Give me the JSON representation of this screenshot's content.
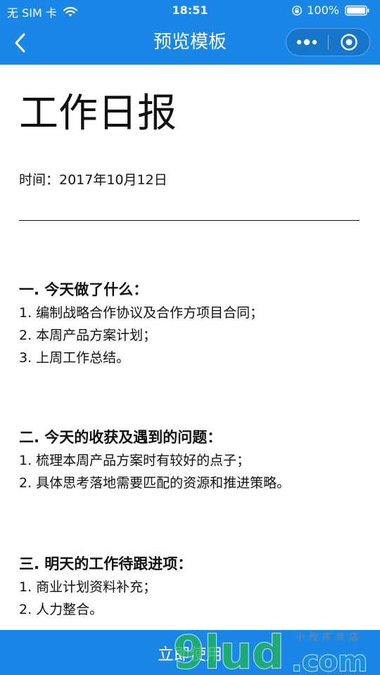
{
  "status_bar": {
    "carrier": "无 SIM 卡",
    "time": "18:51",
    "battery": "100%"
  },
  "nav": {
    "title": "预览模板"
  },
  "document": {
    "title": "工作日报",
    "date": "时间：2017年10月12日",
    "sections": [
      {
        "heading": "一. 今天做了什么：",
        "items": [
          "1. 编制战略合作协议及合作方项目合同；",
          "2. 本周产品方案计划；",
          "3. 上周工作总结。"
        ]
      },
      {
        "heading": "二. 今天的收获及遇到的问题：",
        "items": [
          "1. 梳理本周产品方案时有较好的点子；",
          "2. 具体思考落地需要匹配的资源和推进策略。"
        ]
      },
      {
        "heading": "三. 明天的工作待跟进项：",
        "items": [
          "1. 商业计划资料补充；",
          "2. 人力整合。"
        ]
      }
    ]
  },
  "footer": {
    "use_label": "立即使用"
  },
  "watermark": {
    "brand": "9lud",
    "domain": ".com",
    "tagline": "小程序商店"
  },
  "colors": {
    "brand_blue": "#1a86e8",
    "watermark_green": "#1fb35a",
    "watermark_blue": "#1c8fd6"
  },
  "icons": {
    "wifi": "wifi-icon",
    "lock": "orientation-lock-icon",
    "battery": "battery-icon",
    "back": "chevron-left-icon",
    "more": "more-dots-icon",
    "close": "target-circle-icon"
  }
}
